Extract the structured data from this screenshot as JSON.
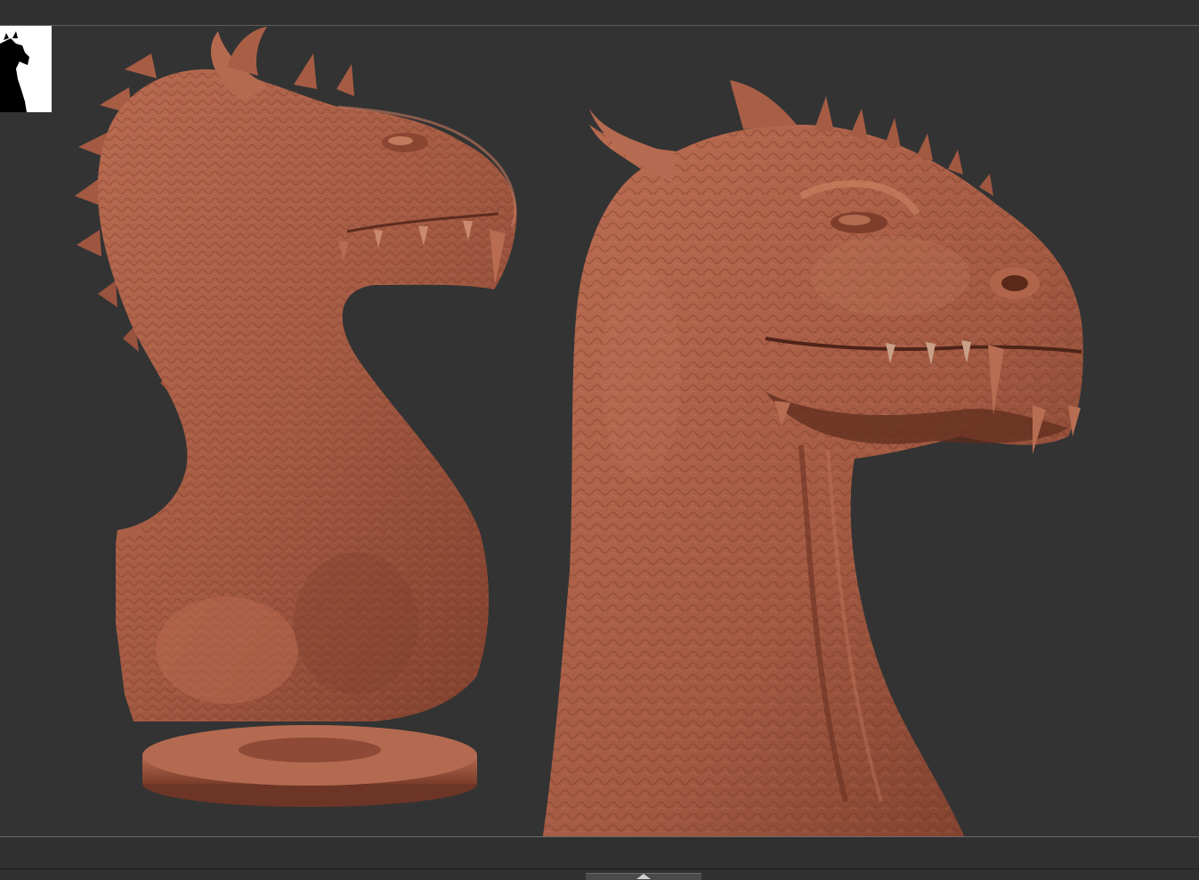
{
  "app": {
    "background_color": "#323232",
    "model_color": "#a95e47"
  },
  "thumbnail": {
    "icon": "dragon-silhouette-icon"
  },
  "viewport": {
    "models": [
      {
        "label": "dragon-bust-full-view"
      },
      {
        "label": "dragon-head-closeup-view"
      }
    ]
  },
  "scrollbar": {
    "icon": "chevron-up-icon"
  }
}
